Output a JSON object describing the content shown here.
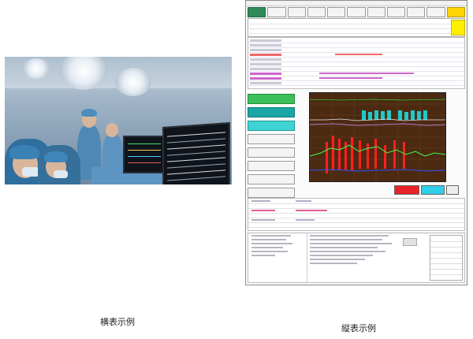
{
  "captions": {
    "horizontal": "横表示例",
    "vertical": "縦表示例"
  },
  "colors": {
    "active_tab": "#2e8b57",
    "warn": "#ffd400",
    "alert_red": "#e8232a",
    "info_cyan": "#2fd0e8",
    "chart_bg": "#4c2a12"
  },
  "icons": {
    "monitor": "monitor-icon"
  }
}
